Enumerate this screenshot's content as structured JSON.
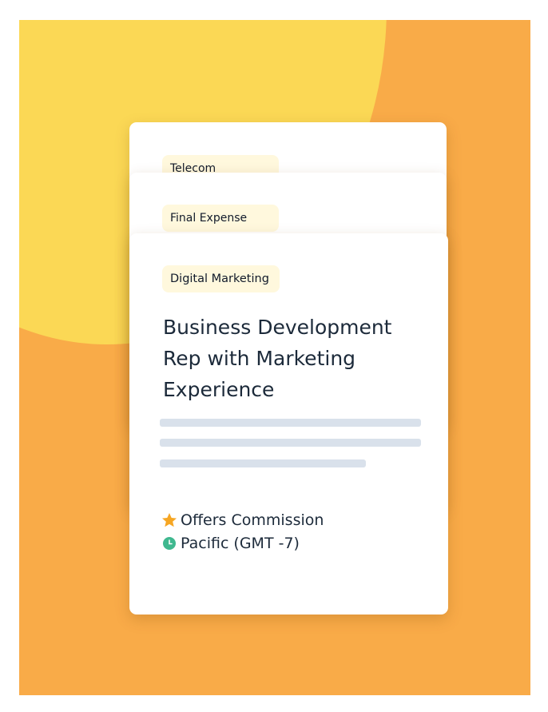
{
  "cards": [
    {
      "tag": "Telecom"
    },
    {
      "tag": "Final Expense"
    },
    {
      "tag": "Digital Marketing",
      "title": "Business Development Rep with Marketing Experience",
      "meta": [
        {
          "icon": "star-icon",
          "text": "Offers Commission"
        },
        {
          "icon": "clock-icon",
          "text": "Pacific (GMT -7)"
        }
      ]
    }
  ],
  "colors": {
    "background": "#f9ab48",
    "sun": "#fbd855",
    "tag_bg": "#fff8dd",
    "star": "#f6a623",
    "clock": "#3fb88f",
    "placeholder_line": "#d9e1eb"
  }
}
